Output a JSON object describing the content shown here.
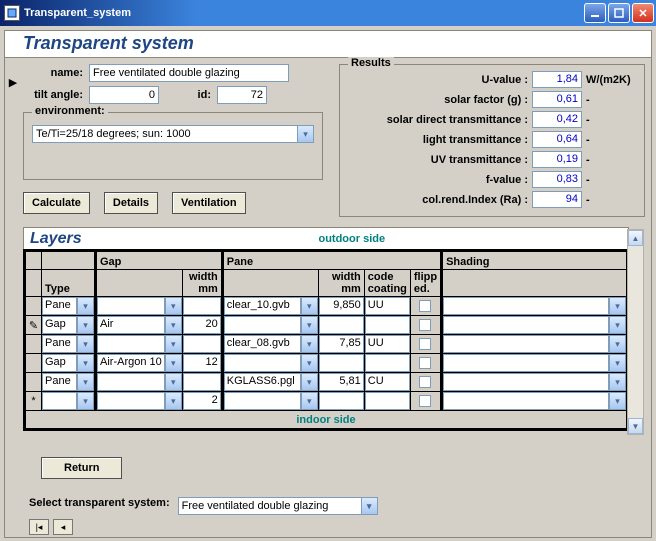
{
  "window": {
    "title": "Transparent_system"
  },
  "banner": "Transparent system",
  "form": {
    "name_label": "name:",
    "name_value": "Free ventilated double glazing",
    "tilt_label": "tilt angle:",
    "tilt_value": "0",
    "id_label": "id:",
    "id_value": "72"
  },
  "environment": {
    "title": "environment:",
    "value": "Te/Ti=25/18 degrees; sun: 1000"
  },
  "buttons": {
    "calculate": "Calculate",
    "details": "Details",
    "ventilation": "Ventilation",
    "return": "Return"
  },
  "results": {
    "title": "Results",
    "rows": [
      {
        "label": "U-value :",
        "value": "1,84",
        "unit": "W/(m2K)"
      },
      {
        "label": "solar factor (g) :",
        "value": "0,61",
        "unit": "-"
      },
      {
        "label": "solar direct transmittance :",
        "value": "0,42",
        "unit": "-"
      },
      {
        "label": "light  transmittance :",
        "value": "0,64",
        "unit": "-"
      },
      {
        "label": "UV transmittance :",
        "value": "0,19",
        "unit": "-"
      },
      {
        "label": "f-value :",
        "value": "0,83",
        "unit": "-"
      },
      {
        "label": "col.rend.Index (Ra) :",
        "value": "94",
        "unit": "-"
      }
    ]
  },
  "layers": {
    "title": "Layers",
    "outdoor": "outdoor side",
    "indoor": "indoor side",
    "headers": {
      "type": "Type",
      "gap": "Gap",
      "gap_width": "width mm",
      "pane": "Pane",
      "pane_width": "width mm",
      "code": "code coating",
      "flipped": "flipp ed.",
      "shading": "Shading"
    },
    "rows": [
      {
        "marker": "",
        "type": "Pane",
        "gap": "",
        "gwidth": "",
        "pane": "clear_10.gvb",
        "pwidth": "9,850",
        "code": "UU",
        "flip": false,
        "shading": ""
      },
      {
        "marker": "✎",
        "type": "Gap",
        "gap": "Air",
        "gwidth": "20",
        "pane": "",
        "pwidth": "",
        "code": "",
        "flip": false,
        "shading": ""
      },
      {
        "marker": "",
        "type": "Pane",
        "gap": "",
        "gwidth": "",
        "pane": "clear_08.gvb",
        "pwidth": "7,85",
        "code": "UU",
        "flip": false,
        "shading": ""
      },
      {
        "marker": "",
        "type": "Gap",
        "gap": "Air-Argon 10",
        "gwidth": "12",
        "pane": "",
        "pwidth": "",
        "code": "",
        "flip": false,
        "shading": ""
      },
      {
        "marker": "",
        "type": "Pane",
        "gap": "",
        "gwidth": "",
        "pane": "KGLASS6.pgl",
        "pwidth": "5,81",
        "code": "CU",
        "flip": false,
        "shading": ""
      },
      {
        "marker": "*",
        "type": "",
        "gap": "",
        "gwidth": "2",
        "pane": "",
        "pwidth": "",
        "code": "",
        "flip": false,
        "shading": ""
      }
    ]
  },
  "select": {
    "label": "Select transparent system:",
    "value": "Free ventilated double glazing"
  }
}
